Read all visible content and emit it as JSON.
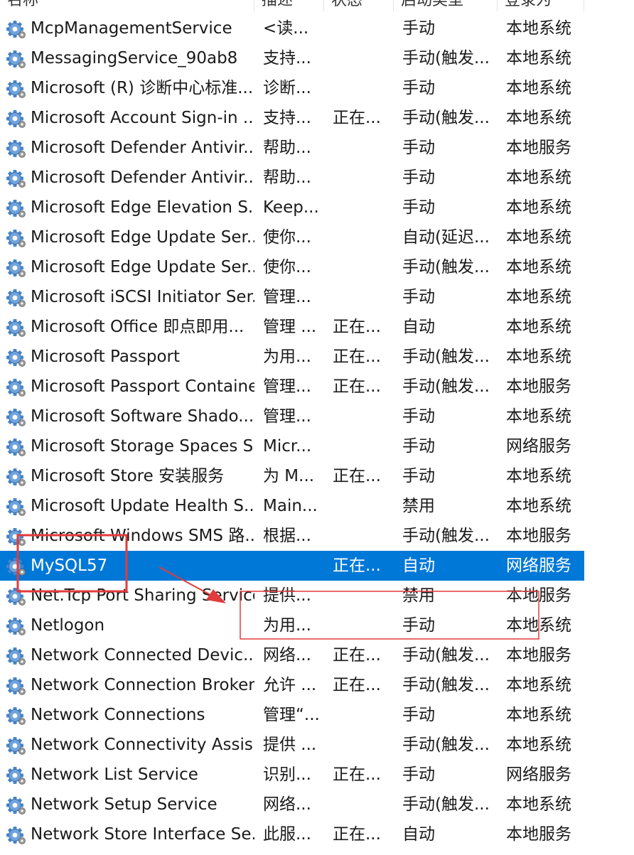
{
  "columns": {
    "name": "名称",
    "description": "描述",
    "status": "状态",
    "startup": "启动类型",
    "logon": "登录为"
  },
  "services": [
    {
      "name": "McpManagementService",
      "description": "<读...",
      "status": "",
      "startup": "手动",
      "logon": "本地系统"
    },
    {
      "name": "MessagingService_90ab8",
      "description": "支持...",
      "status": "",
      "startup": "手动(触发...",
      "logon": "本地系统"
    },
    {
      "name": "Microsoft (R) 诊断中心标准...",
      "description": "诊断...",
      "status": "",
      "startup": "手动",
      "logon": "本地系统"
    },
    {
      "name": "Microsoft Account Sign-in ...",
      "description": "支持...",
      "status": "正在...",
      "startup": "手动(触发...",
      "logon": "本地系统"
    },
    {
      "name": "Microsoft Defender Antivir...",
      "description": "帮助...",
      "status": "",
      "startup": "手动",
      "logon": "本地服务"
    },
    {
      "name": "Microsoft Defender Antivir...",
      "description": "帮助...",
      "status": "",
      "startup": "手动",
      "logon": "本地系统"
    },
    {
      "name": "Microsoft Edge Elevation S...",
      "description": "Keep...",
      "status": "",
      "startup": "手动",
      "logon": "本地系统"
    },
    {
      "name": "Microsoft Edge Update Ser...",
      "description": "使你...",
      "status": "",
      "startup": "自动(延迟...",
      "logon": "本地系统"
    },
    {
      "name": "Microsoft Edge Update Ser...",
      "description": "使你...",
      "status": "",
      "startup": "手动(触发...",
      "logon": "本地系统"
    },
    {
      "name": "Microsoft iSCSI Initiator Ser...",
      "description": "管理...",
      "status": "",
      "startup": "手动",
      "logon": "本地系统"
    },
    {
      "name": "Microsoft Office 即点即用...",
      "description": "管理 ...",
      "status": "正在...",
      "startup": "自动",
      "logon": "本地系统"
    },
    {
      "name": "Microsoft Passport",
      "description": "为用...",
      "status": "正在...",
      "startup": "手动(触发...",
      "logon": "本地系统"
    },
    {
      "name": "Microsoft Passport Container",
      "description": "管理...",
      "status": "正在...",
      "startup": "手动(触发...",
      "logon": "本地服务"
    },
    {
      "name": "Microsoft Software Shado...",
      "description": "管理...",
      "status": "",
      "startup": "手动",
      "logon": "本地系统"
    },
    {
      "name": "Microsoft Storage Spaces S...",
      "description": "Micr...",
      "status": "",
      "startup": "手动",
      "logon": "网络服务"
    },
    {
      "name": "Microsoft Store 安装服务",
      "description": "为 M...",
      "status": "正在...",
      "startup": "手动",
      "logon": "本地系统"
    },
    {
      "name": "Microsoft Update Health S...",
      "description": "Main...",
      "status": "",
      "startup": "禁用",
      "logon": "本地系统"
    },
    {
      "name": "Microsoft Windows SMS 路...",
      "description": "根据...",
      "status": "",
      "startup": "手动(触发...",
      "logon": "本地服务"
    },
    {
      "name": "MySQL57",
      "description": "",
      "status": "正在...",
      "startup": "自动",
      "logon": "网络服务",
      "selected": true
    },
    {
      "name": "Net.Tcp Port Sharing Service",
      "description": "提供...",
      "status": "",
      "startup": "禁用",
      "logon": "本地服务"
    },
    {
      "name": "Netlogon",
      "description": "为用...",
      "status": "",
      "startup": "手动",
      "logon": "本地系统"
    },
    {
      "name": "Network Connected Devic...",
      "description": "网络...",
      "status": "正在...",
      "startup": "手动(触发...",
      "logon": "本地服务"
    },
    {
      "name": "Network Connection Broker",
      "description": "允许 ...",
      "status": "正在...",
      "startup": "手动(触发...",
      "logon": "本地系统"
    },
    {
      "name": "Network Connections",
      "description": "管理“...",
      "status": "",
      "startup": "手动",
      "logon": "本地系统"
    },
    {
      "name": "Network Connectivity Assis...",
      "description": "提供 ...",
      "status": "",
      "startup": "手动(触发...",
      "logon": "本地系统"
    },
    {
      "name": "Network List Service",
      "description": "识别...",
      "status": "正在...",
      "startup": "手动",
      "logon": "网络服务"
    },
    {
      "name": "Network Setup Service",
      "description": "网络...",
      "status": "",
      "startup": "手动(触发...",
      "logon": "本地系统"
    },
    {
      "name": "Network Store Interface Se...",
      "description": "此服...",
      "status": "正在...",
      "startup": "自动",
      "logon": "本地服务"
    }
  ],
  "colors": {
    "selection": "#0078d7",
    "annotation": "#e23b3b",
    "gear": "#4a86c8"
  },
  "icons": {
    "service": "gear-icon"
  }
}
